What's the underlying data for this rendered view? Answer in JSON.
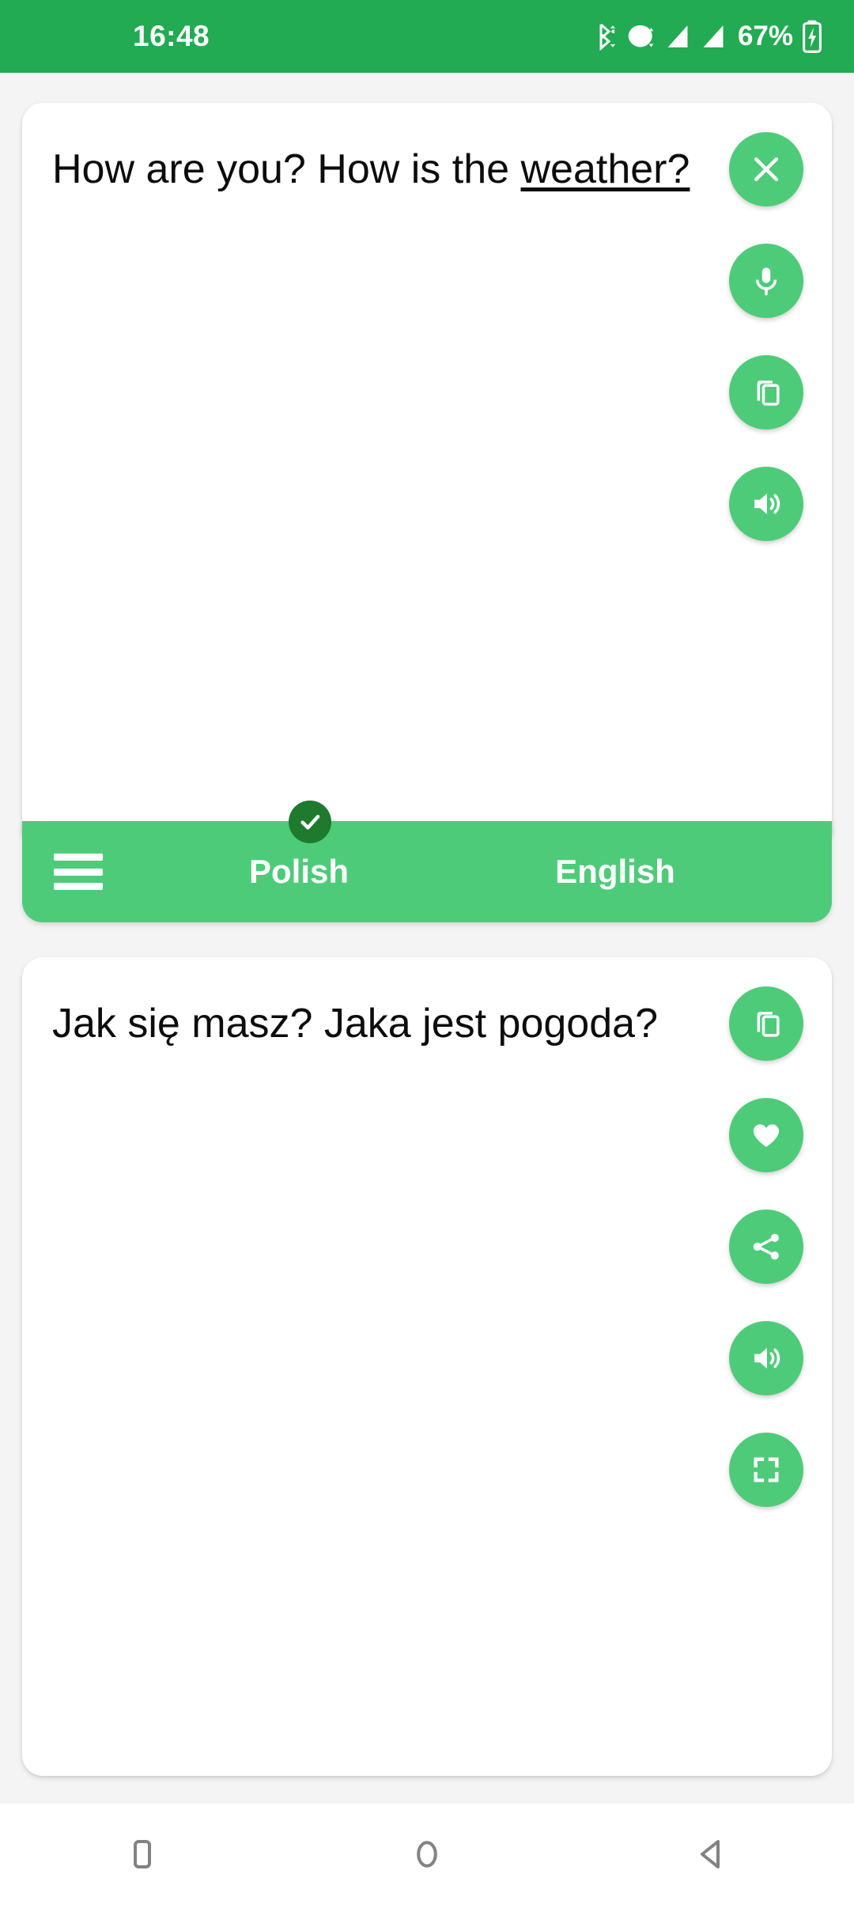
{
  "status_bar": {
    "time": "16:48",
    "battery_percent": "67%",
    "icons": [
      "bluetooth-icon",
      "wifi-icon",
      "signal-icon-1",
      "signal-icon-2",
      "battery-charging-icon"
    ],
    "background_color": "#22ab52"
  },
  "theme": {
    "accent_color": "#4ecb79",
    "accent_dark_color": "#1f7a2e",
    "page_background": "#f4f4f4",
    "card_background": "#ffffff",
    "text_color": "#0c0c0c"
  },
  "source_card": {
    "text": "How are you? How is the ",
    "text_underlined": "weather?",
    "buttons": [
      {
        "name": "clear-button",
        "icon": "close-icon"
      },
      {
        "name": "voice-input-button",
        "icon": "microphone-icon"
      },
      {
        "name": "copy-button",
        "icon": "copy-icon"
      },
      {
        "name": "speak-button",
        "icon": "speaker-icon"
      }
    ]
  },
  "language_bar": {
    "source_language": "Polish",
    "target_language": "English",
    "menu_icon": "hamburger-menu-icon",
    "badge_icon": "checkmark-icon"
  },
  "target_card": {
    "text": "Jak się masz? Jaka jest pogoda?",
    "buttons": [
      {
        "name": "copy-button",
        "icon": "copy-icon"
      },
      {
        "name": "favorite-button",
        "icon": "heart-icon"
      },
      {
        "name": "share-button",
        "icon": "share-icon"
      },
      {
        "name": "speak-button",
        "icon": "speaker-icon"
      },
      {
        "name": "fullscreen-button",
        "icon": "fullscreen-icon"
      }
    ]
  },
  "navigation_bar": {
    "buttons": [
      {
        "name": "recents-button",
        "icon": "square-icon"
      },
      {
        "name": "home-button",
        "icon": "circle-icon"
      },
      {
        "name": "back-button",
        "icon": "triangle-left-icon"
      }
    ]
  }
}
